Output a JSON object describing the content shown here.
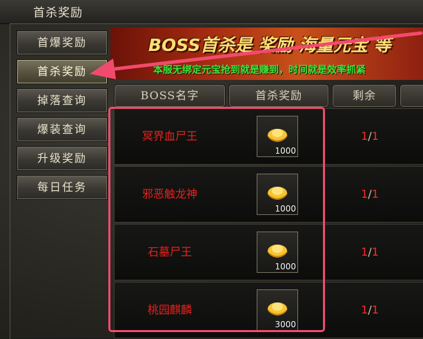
{
  "window": {
    "title": "首杀奖励"
  },
  "sidebar": {
    "items": [
      {
        "label": "首爆奖励",
        "active": false
      },
      {
        "label": "首杀奖励",
        "active": true
      },
      {
        "label": "掉落查询",
        "active": false
      },
      {
        "label": "爆装查询",
        "active": false
      },
      {
        "label": "升级奖励",
        "active": false
      },
      {
        "label": "每日任务",
        "active": false
      }
    ]
  },
  "banner": {
    "title": "BOSS首杀是 奖励 海量元宝 等",
    "subtitle": "本服无绑定元宝抢到就是赚到，时间就是效率抓紧"
  },
  "table": {
    "headers": [
      "BOSS名字",
      "首杀奖励",
      "剩余"
    ],
    "rows": [
      {
        "boss": "冥界血尸王",
        "reward_count": "1000",
        "remaining": "1",
        "total": "1"
      },
      {
        "boss": "邪恶触龙神",
        "reward_count": "1000",
        "remaining": "1",
        "total": "1"
      },
      {
        "boss": "石墓尸王",
        "reward_count": "1000",
        "remaining": "1",
        "total": "1"
      },
      {
        "boss": "桃园麒麟",
        "reward_count": "3000",
        "remaining": "1",
        "total": "1"
      }
    ]
  },
  "colors": {
    "boss_name": "#e8221b",
    "highlight": "#f24a6d",
    "subtitle": "#3ee33a",
    "banner_title": "#ffe074"
  },
  "icons": {
    "reward": "gold-ingot-icon",
    "pointer": "arrow-pointer-icon"
  }
}
